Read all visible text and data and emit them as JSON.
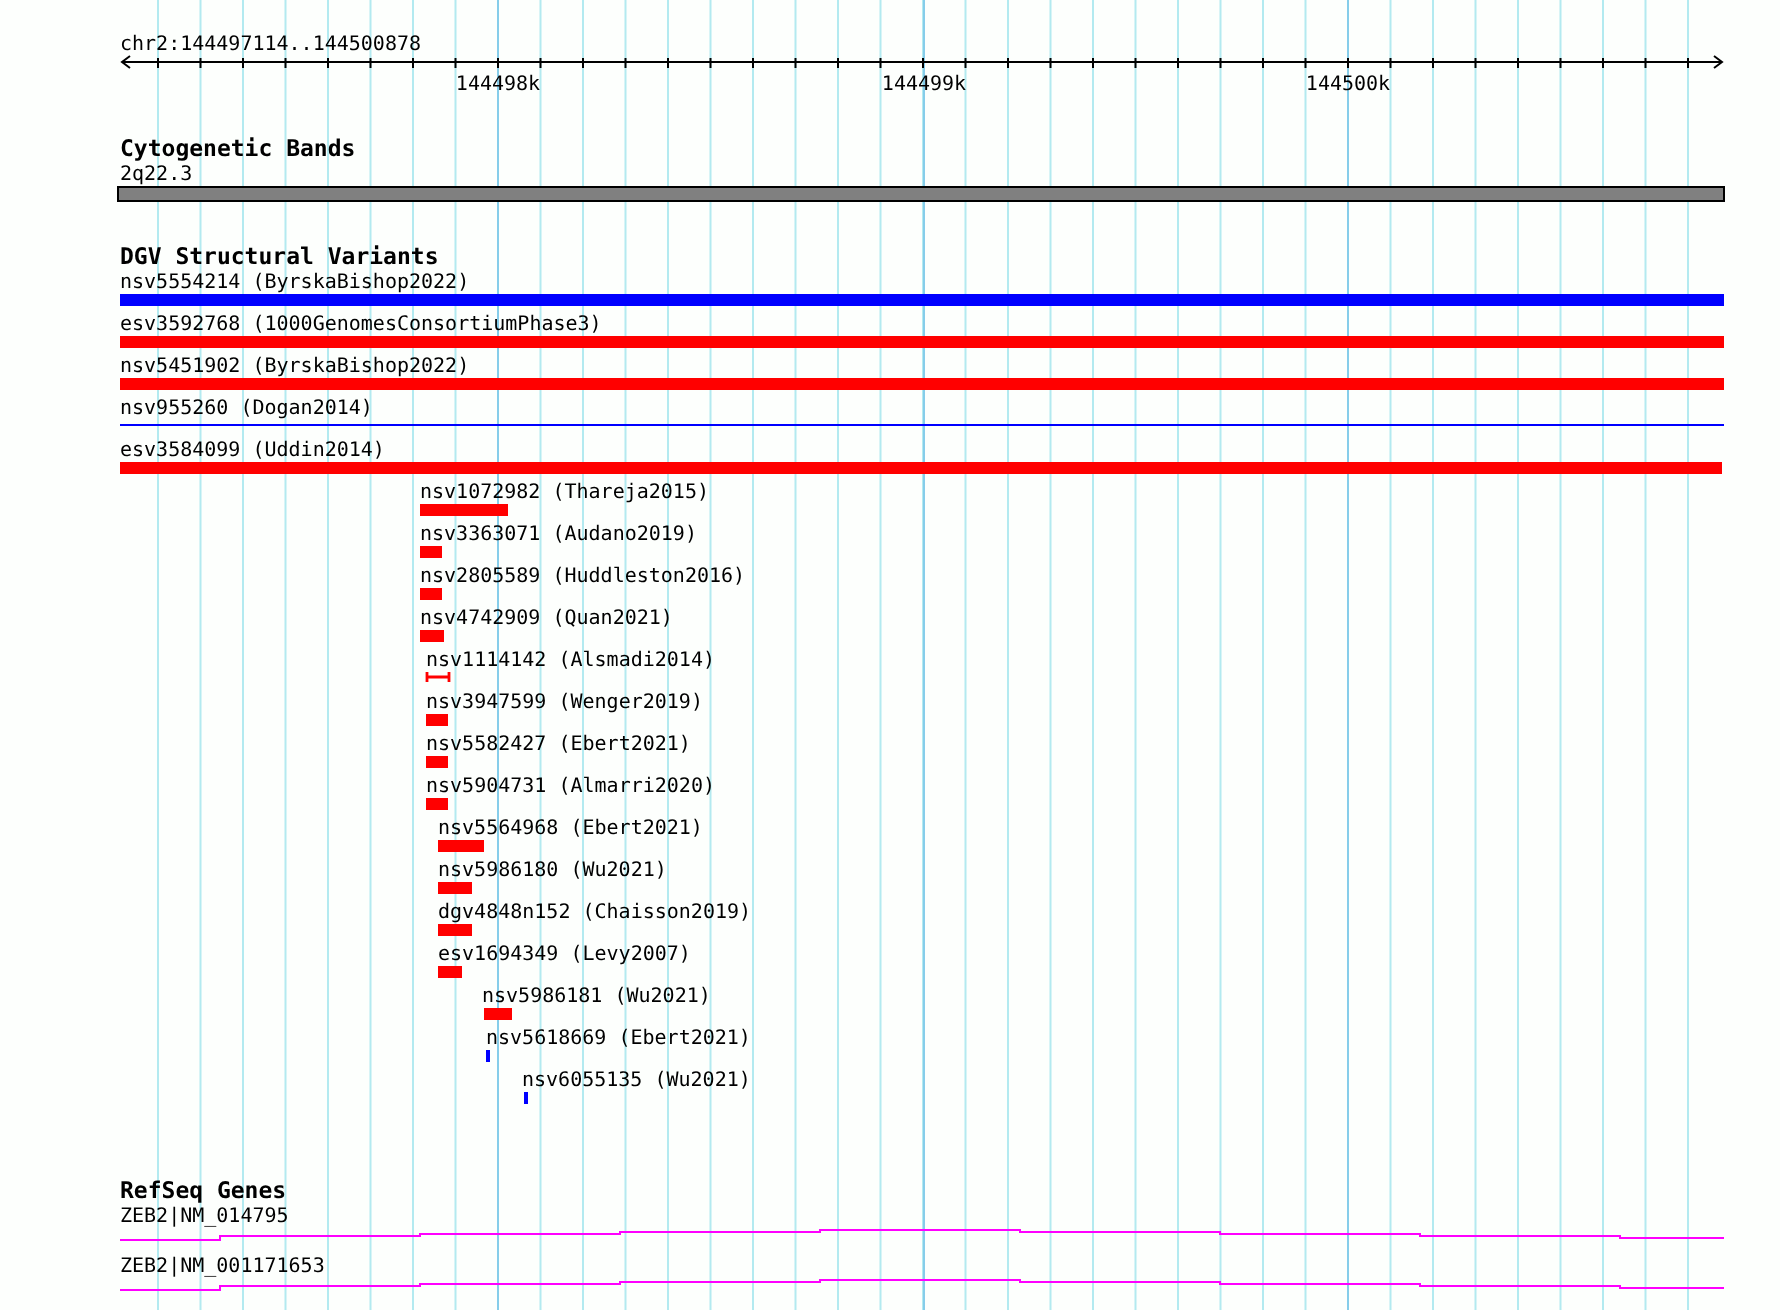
{
  "ruler": {
    "region": "chr2:144497114..144500878",
    "ticks": [
      "144498k",
      "144499k",
      "144500k"
    ]
  },
  "cytogenetic_bands": {
    "title": "Cytogenetic Bands",
    "band": "2q22.3"
  },
  "dgv_structural_variants": {
    "title": "DGV Structural Variants",
    "variants": [
      {
        "label": "nsv5554214 (ByrskaBishop2022)",
        "kind": "bar",
        "color": "#0000ff"
      },
      {
        "label": "esv3592768 (1000GenomesConsortiumPhase3)",
        "kind": "bar",
        "color": "#ff0000"
      },
      {
        "label": "nsv5451902 (ByrskaBishop2022)",
        "kind": "bar",
        "color": "#ff0000"
      },
      {
        "label": "nsv955260 (Dogan2014)",
        "kind": "line",
        "color": "#0000ff"
      },
      {
        "label": "esv3584099 (Uddin2014)",
        "kind": "bar",
        "color": "#ff0000"
      },
      {
        "label": "nsv1072982 (Thareja2015)",
        "kind": "bar",
        "color": "#ff0000"
      },
      {
        "label": "nsv3363071 (Audano2019)",
        "kind": "bar",
        "color": "#ff0000"
      },
      {
        "label": "nsv2805589 (Huddleston2016)",
        "kind": "bar",
        "color": "#ff0000"
      },
      {
        "label": "nsv4742909 (Quan2021)",
        "kind": "bar",
        "color": "#ff0000"
      },
      {
        "label": "nsv1114142 (Alsmadi2014)",
        "kind": "interval",
        "color": "#ff0000"
      },
      {
        "label": "nsv3947599 (Wenger2019)",
        "kind": "bar",
        "color": "#ff0000"
      },
      {
        "label": "nsv5582427 (Ebert2021)",
        "kind": "bar",
        "color": "#ff0000"
      },
      {
        "label": "nsv5904731 (Almarri2020)",
        "kind": "bar",
        "color": "#ff0000"
      },
      {
        "label": "nsv5564968 (Ebert2021)",
        "kind": "bar",
        "color": "#ff0000"
      },
      {
        "label": "nsv5986180 (Wu2021)",
        "kind": "bar",
        "color": "#ff0000"
      },
      {
        "label": "dgv4848n152 (Chaisson2019)",
        "kind": "bar",
        "color": "#ff0000"
      },
      {
        "label": "esv1694349 (Levy2007)",
        "kind": "bar",
        "color": "#ff0000"
      },
      {
        "label": "nsv5986181 (Wu2021)",
        "kind": "bar",
        "color": "#ff0000"
      },
      {
        "label": "nsv5618669 (Ebert2021)",
        "kind": "bar",
        "color": "#0000ff"
      },
      {
        "label": "nsv6055135 (Wu2021)",
        "kind": "bar",
        "color": "#0000ff"
      }
    ]
  },
  "refseq_genes": {
    "title": "RefSeq Genes",
    "transcripts": [
      {
        "label": "ZEB2|NM_014795"
      },
      {
        "label": "ZEB2|NM_001171653"
      }
    ]
  }
}
